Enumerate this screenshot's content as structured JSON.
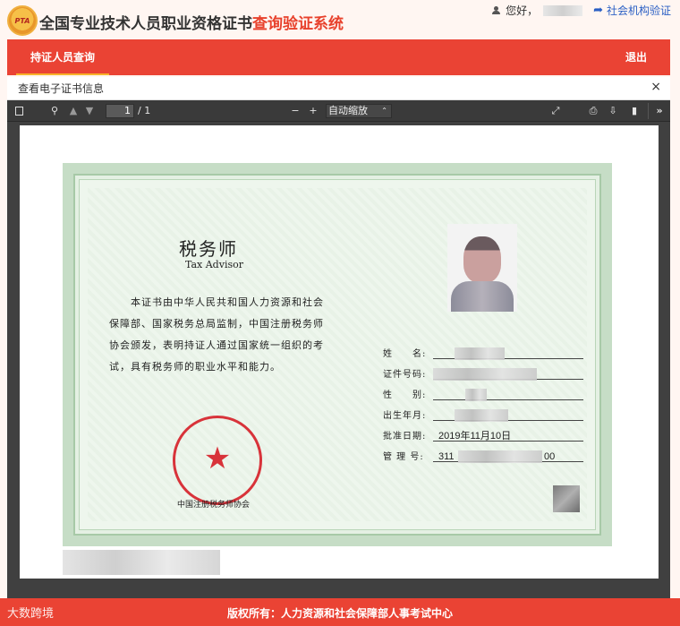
{
  "header": {
    "logo_text": "PTA",
    "title_main": "全国专业技术人员职业资格证书",
    "title_accent": "查询验证系统",
    "greeting": "您好，",
    "org_link": "社会机构验证"
  },
  "nav": {
    "tab_active": "持证人员查询",
    "logout": "退出"
  },
  "dialog": {
    "title": "查看电子证书信息",
    "close": "×"
  },
  "pdf_toolbar": {
    "page_current": "1",
    "page_total": "/ 1",
    "zoom_value": "自动缩放",
    "icons": [
      "sidebar-toggle-icon",
      "search-icon",
      "page-up-icon",
      "page-down-icon",
      "zoom-out-icon",
      "zoom-in-icon",
      "fullscreen-icon",
      "print-icon",
      "download-icon",
      "bookmark-icon",
      "more-tools-icon"
    ]
  },
  "certificate": {
    "title": "税务师",
    "subtitle": "Tax Advisor",
    "body": "本证书由中华人民共和国人力资源和社会保障部、国家税务总局监制，中国注册税务师协会颁发，表明持证人通过国家统一组织的考试，具有税务师的职业水平和能力。",
    "seal_text": "中国注册税务师协会",
    "issuer": "中国注册税务师协会",
    "fields": [
      {
        "label": "姓　　名:",
        "value": ""
      },
      {
        "label": "证件号码:",
        "value": ""
      },
      {
        "label": "性　　别:",
        "value": ""
      },
      {
        "label": "出生年月:",
        "value": ""
      },
      {
        "label": "批准日期:",
        "value": "2019年11月10日"
      },
      {
        "label": "管 理 号:",
        "value": "311"
      }
    ],
    "trailing_digits": "00"
  },
  "footer": {
    "copyright": "版权所有：人力资源和社会保障部人事考试中心",
    "watermark": "大数跨境"
  }
}
